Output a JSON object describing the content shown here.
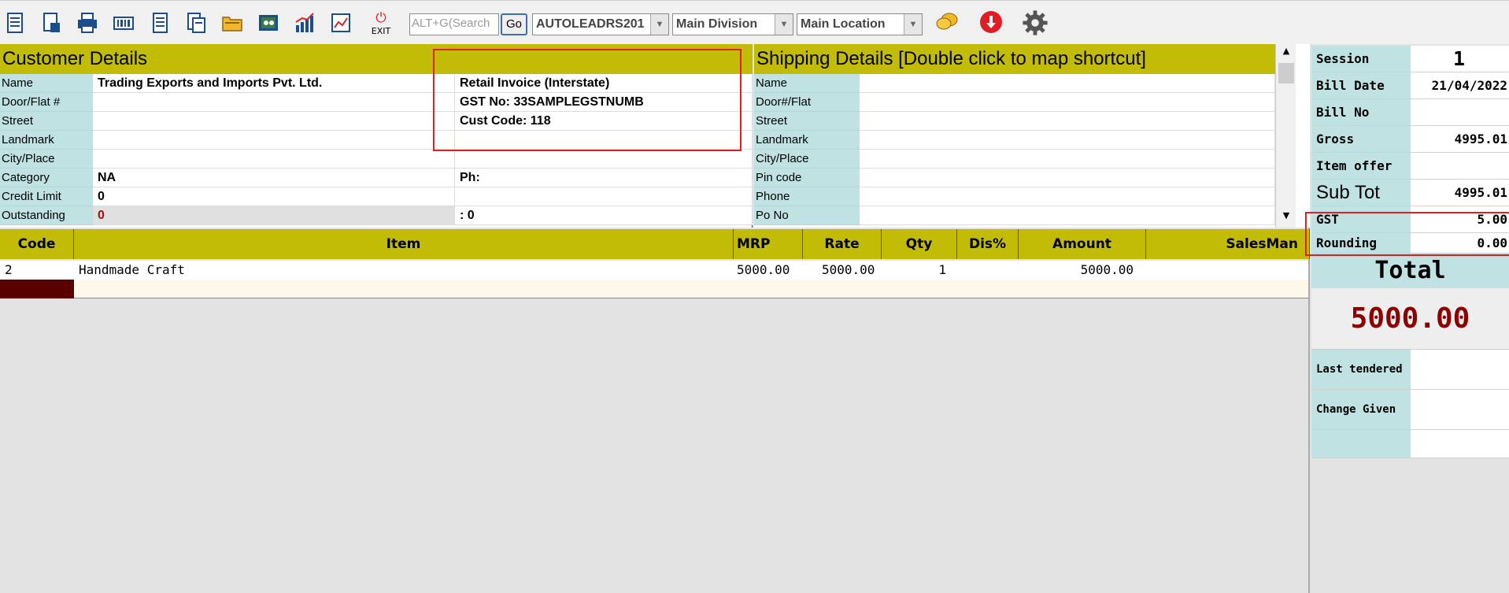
{
  "toolbar": {
    "exit_label": "EXIT",
    "search_placeholder": "ALT+G(Search",
    "go_label": "Go",
    "combos": [
      "AUTOLEADRS201",
      "Main Division",
      "Main Location"
    ]
  },
  "customer": {
    "title": "Customer Details",
    "labels": [
      "Name",
      "Door/Flat #",
      "Street",
      "Landmark",
      "City/Place",
      "Category",
      "Credit Limit",
      "Outstanding"
    ],
    "values": [
      "Trading Exports and Imports Pvt. Ltd.",
      "",
      "",
      "",
      "",
      "NA",
      "0",
      "0"
    ],
    "info": [
      "Retail Invoice (Interstate)",
      "GST No: 33SAMPLEGSTNUMB",
      "Cust Code: 118",
      "",
      "",
      "Ph:",
      "",
      ":  0"
    ]
  },
  "shipping": {
    "title": "Shipping Details   [Double click to map shortcut]",
    "labels": [
      "Name",
      "Door#/Flat",
      "Street",
      "Landmark",
      "City/Place",
      "Pin code",
      "Phone",
      "Po No"
    ]
  },
  "grid": {
    "headers": [
      "Code",
      "Item",
      "MRP",
      "Rate",
      "Qty",
      "Dis%",
      "Amount",
      "SalesMan"
    ],
    "rows": [
      {
        "code": "2",
        "item": "Handmade Craft",
        "mrp": "5000.00",
        "rate": "5000.00",
        "qty": "1",
        "dis": "",
        "amount": "5000.00",
        "salesman": ""
      }
    ]
  },
  "summary": {
    "session_label": "Session",
    "session_value": "1",
    "billdate_label": "Bill Date",
    "billdate_value": "21/04/2022",
    "billno_label": "Bill No",
    "billno_value": "",
    "gross_label": "Gross",
    "gross_value": "4995.01",
    "itemoffer_label": "Item offer",
    "itemoffer_value": "",
    "subtot_label": "Sub Tot",
    "subtot_value": "4995.01",
    "gst_label": "GST",
    "gst_value": "5.00",
    "rounding_label": "Rounding",
    "rounding_value": "0.00",
    "total_label": "Total",
    "total_value": "5000.00",
    "lasttendered_label": "Last tendered",
    "lasttendered_value": "",
    "change_label": "Change Given",
    "change_value": ""
  },
  "colors": {
    "header": "#c2bc06",
    "label_bg": "#c0e2e2",
    "total": "#8b0000",
    "highlight": "#e02020"
  }
}
